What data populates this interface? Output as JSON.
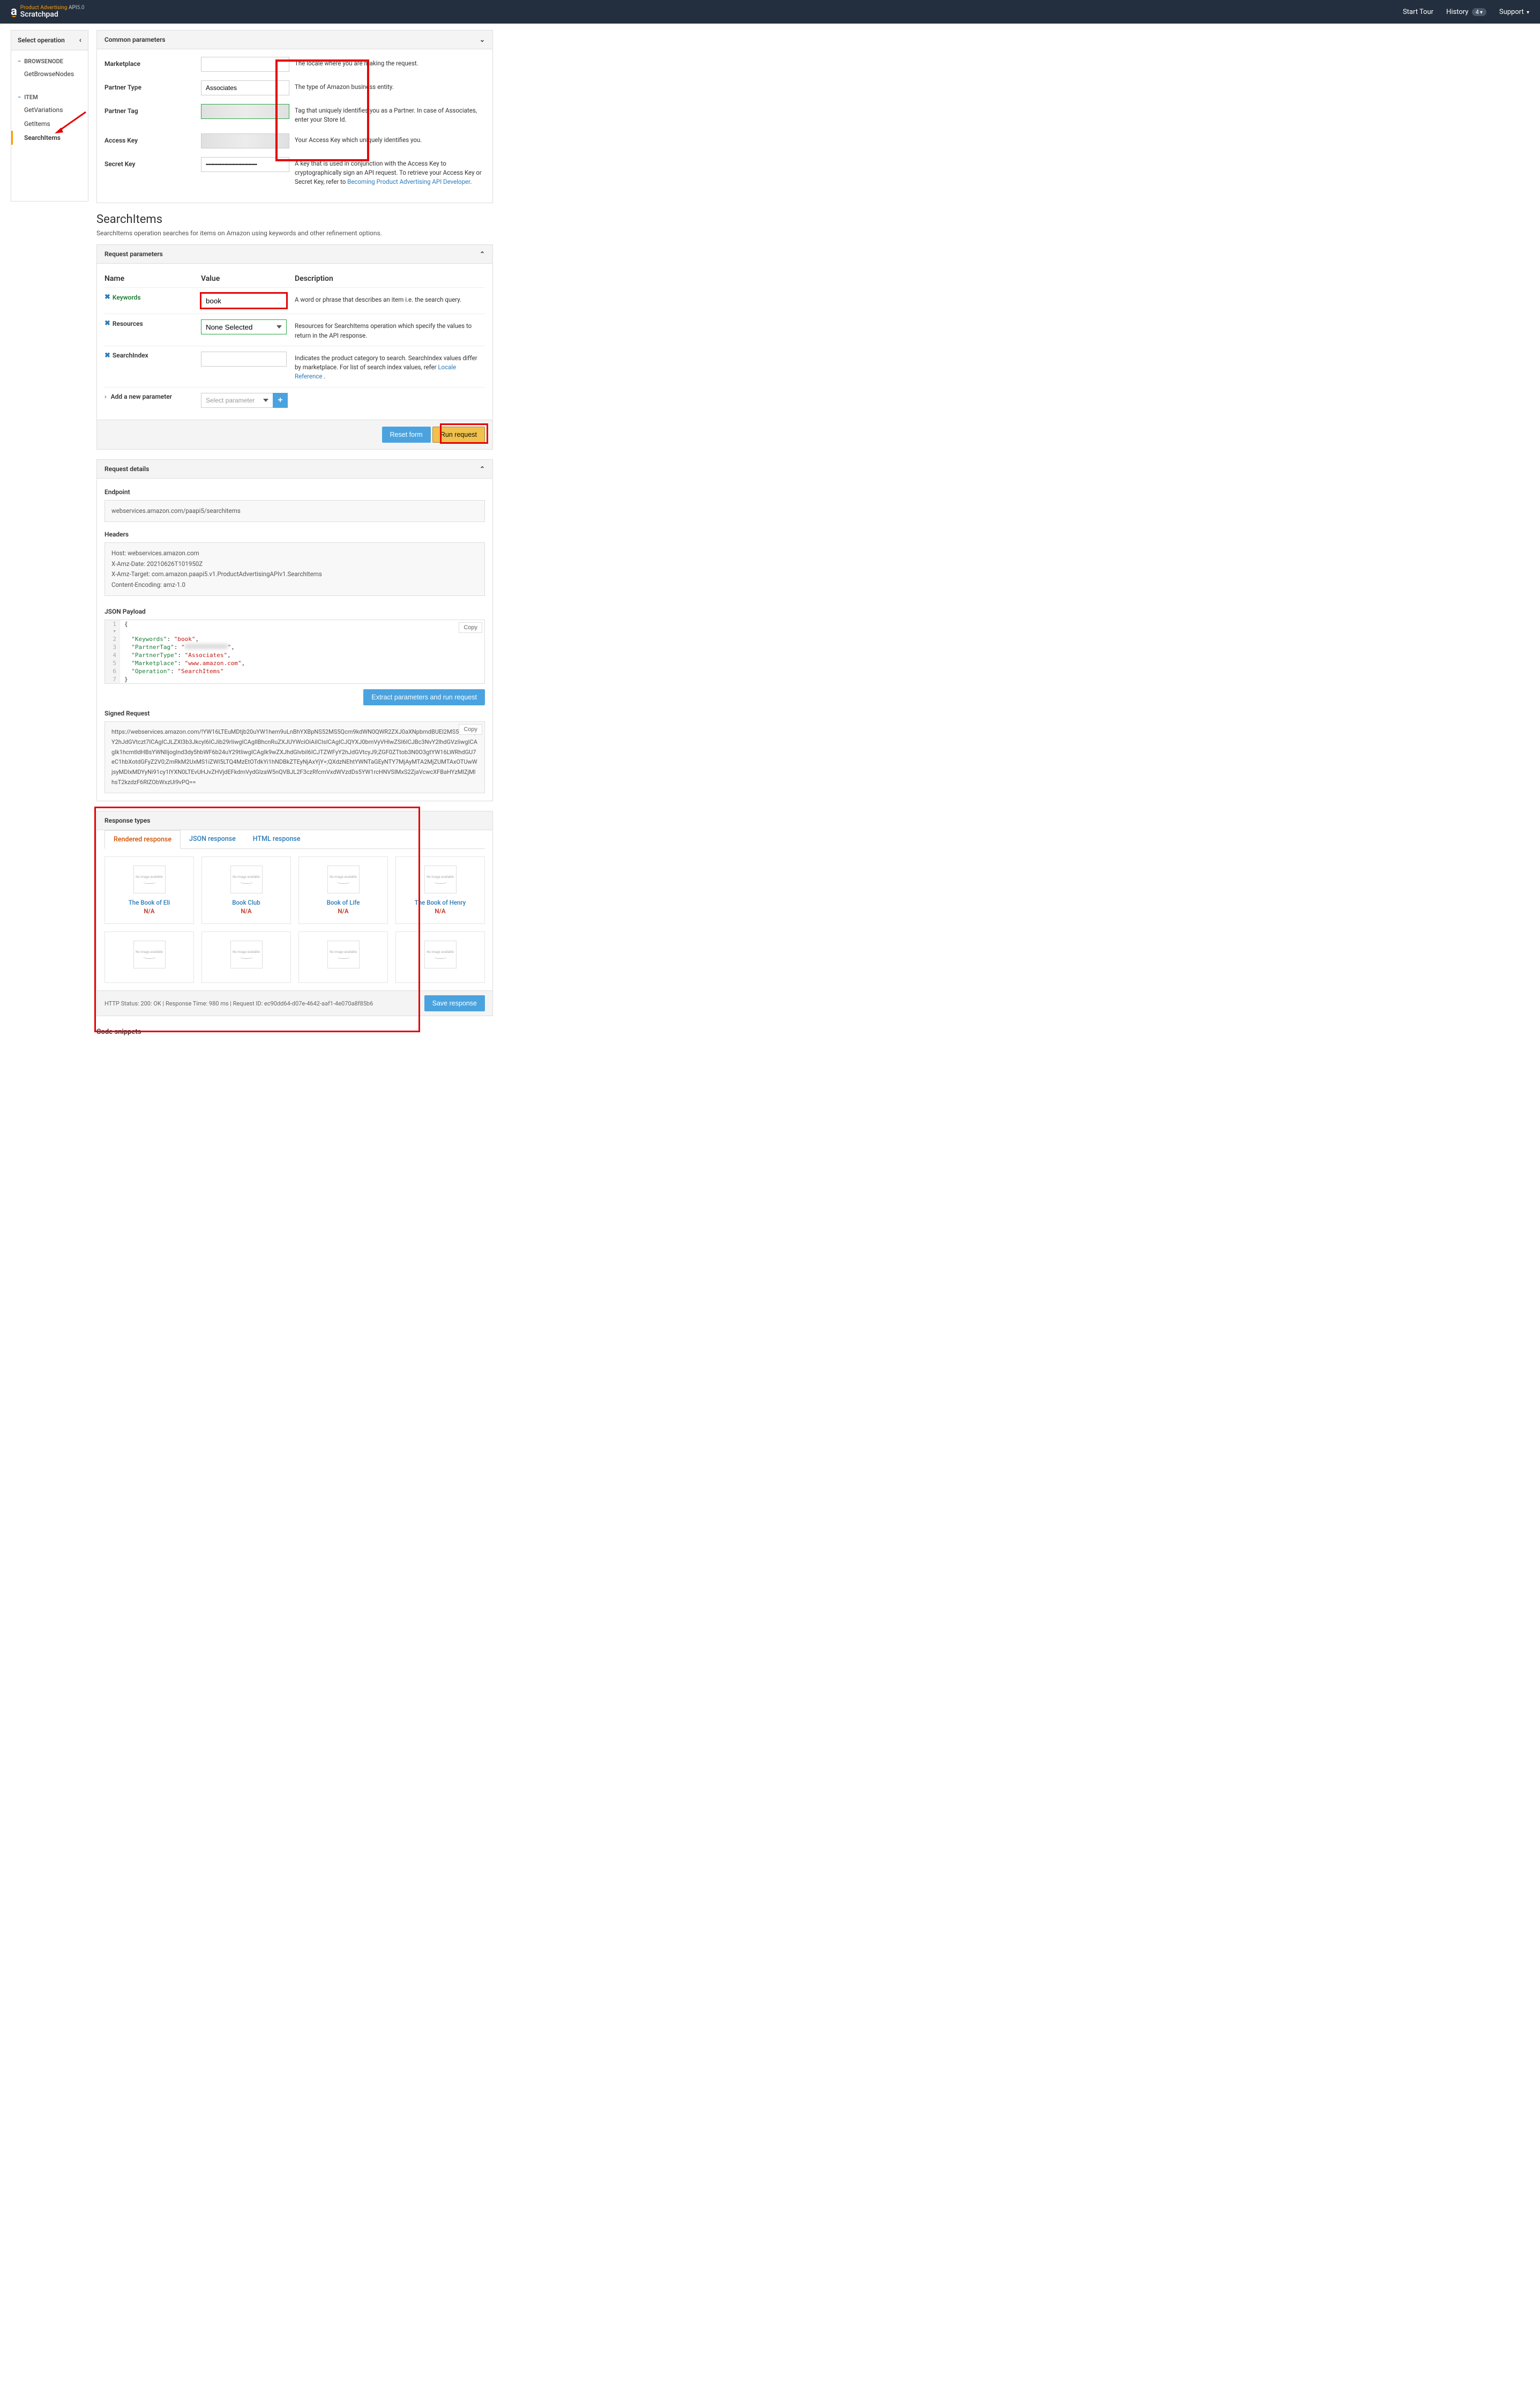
{
  "header": {
    "brand_line1_a": "Product Advertising ",
    "brand_line1_b": "API",
    "brand_line1_c": "5.0",
    "brand_line2": "Scratchpad",
    "start_tour": "Start Tour",
    "history": "History",
    "history_count": "4",
    "support": "Support"
  },
  "sidebar": {
    "title": "Select operation",
    "groups": [
      {
        "name": "BROWSENODE",
        "items": [
          {
            "label": "GetBrowseNodes"
          }
        ]
      },
      {
        "name": "ITEM",
        "items": [
          {
            "label": "GetVariations"
          },
          {
            "label": "GetItems"
          },
          {
            "label": "SearchItems",
            "active": true
          }
        ]
      }
    ]
  },
  "common": {
    "title": "Common parameters",
    "marketplace_label": "Marketplace",
    "marketplace_desc": "The locale where you are making the request.",
    "partner_type_label": "Partner Type",
    "partner_type_value": "Associates",
    "partner_type_desc": "The type of Amazon business entity.",
    "partner_tag_label": "Partner Tag",
    "partner_tag_desc": "Tag that uniquely identifies you as a Partner. In case of Associates, enter your Store Id.",
    "access_key_label": "Access Key",
    "access_key_desc": "Your Access Key which uniquely identifies you.",
    "secret_key_label": "Secret Key",
    "secret_key_value": "••••••••••••••••••••••••••••••••••••",
    "secret_key_desc_a": "A key that is used in conjunction with the Access Key to cryptographically sign an API request. To retrieve your Access Key or Secret Key, refer to ",
    "secret_key_link": "Becoming Product Advertising API Developer",
    "secret_key_desc_b": "."
  },
  "operation": {
    "title": "SearchItems",
    "subtitle": "SearchItems operation searches for items on Amazon using keywords and other refinement options."
  },
  "reqparams": {
    "title": "Request parameters",
    "h_name": "Name",
    "h_value": "Value",
    "h_desc": "Description",
    "rows": [
      {
        "name": "Keywords",
        "value": "book",
        "desc": "A word or phrase that describes an item i.e. the search query.",
        "style": "keyword"
      },
      {
        "name": "Resources",
        "value": "None Selected",
        "desc": "Resources for SearchItems operation which specify the values to return in the API response.",
        "type": "select"
      },
      {
        "name": "SearchIndex",
        "value": "",
        "desc_a": "Indicates the product category to search. SearchIndex values differ by marketplace. For list of search index values, refer ",
        "link": "Locale Reference",
        "desc_b": " .",
        "type": "text"
      }
    ],
    "add_param": "Add a new parameter",
    "add_placeholder": "Select parameter",
    "reset": "Reset form",
    "run": "Run request"
  },
  "details": {
    "title": "Request details",
    "endpoint_label": "Endpoint",
    "endpoint": "webservices.amazon.com/paapi5/searchitems",
    "headers_label": "Headers",
    "headers": "Host: webservices.amazon.com\nX-Amz-Date: 20210626T101950Z\nX-Amz-Target: com.amazon.paapi5.v1.ProductAdvertisingAPIv1.SearchItems\nContent-Encoding: amz-1.0",
    "json_label": "JSON Payload",
    "copy": "Copy",
    "extract_btn": "Extract parameters and run request",
    "signed_label": "Signed Request",
    "signed": "https://webservices.amazon.com/!YW16LTEuMDtjb20uYW1hem9uLnBhYXBpNS52MS5Qcm9kdWN0QWR2ZXJ0aXNpbmdBUEl2MS5TZWFyY2hJdGVtczt7ICAgICJLZXl3b3JkcyI6ICJib29rIiwgICAgIlBhcnRuZXJUYWciOiAiICIsICAgICJQYXJ0bmVyVHlwZSI6ICJBc3NvY2lhdGVzIiwgICAgIk1hcmtldHBsYWNlIjogInd3dy5hbWF6b24uY29tIiwgICAgIk9wZXJhdGlvbiI6ICJTZWFyY2hJdGVtcyJ9;ZGF0ZTtob3N0O3gtYW16LWRhdGU7eC1hbXotdGFyZ2V0;ZmRkM2UxMS1iZWI5LTQ4MzEtOTdkYi1hNDBkZTEyNjAxYjY=;QXdzNEhtYWNTaGEyNTY7MjAyMTA2MjZUMTAxOTUwWjsyMDIxMDYyNi91cy1lYXN0LTEvUHJvZHVjdEFkdmVydGlzaW5nQVBJL2F3czRfcmVxdWVzdDs5YW1rcHNVSlMxS2ZjaVcwcXFBaHYzMlZjMlhsT2kzdzF6RlZObWxzUi9vPQ=="
  },
  "json_lines": [
    {
      "n": "1",
      "c": "{",
      "fold": true
    },
    {
      "n": "2",
      "c": "  \"Keywords\": \"book\","
    },
    {
      "n": "3",
      "c": "  \"PartnerTag\": \"            \","
    },
    {
      "n": "4",
      "c": "  \"PartnerType\": \"Associates\","
    },
    {
      "n": "5",
      "c": "  \"Marketplace\": \"www.amazon.com\","
    },
    {
      "n": "6",
      "c": "  \"Operation\": \"SearchItems\""
    },
    {
      "n": "7",
      "c": "}"
    }
  ],
  "response": {
    "title": "Response types",
    "tabs": [
      {
        "label": "Rendered response",
        "active": true
      },
      {
        "label": "JSON response"
      },
      {
        "label": "HTML response"
      }
    ],
    "no_image": "No image available",
    "results": [
      {
        "title": "The Book of Eli",
        "price": "N/A"
      },
      {
        "title": "Book Club",
        "price": "N/A"
      },
      {
        "title": "Book of Life",
        "price": "N/A"
      },
      {
        "title": "The Book of Henry",
        "price": "N/A"
      }
    ],
    "status": "HTTP Status: 200: OK | Response Time: 980 ms | Request ID: ec90dd64-d07e-4642-aaf1-4e070a8f85b6",
    "save": "Save response"
  },
  "code_snippets": "Code snippets"
}
